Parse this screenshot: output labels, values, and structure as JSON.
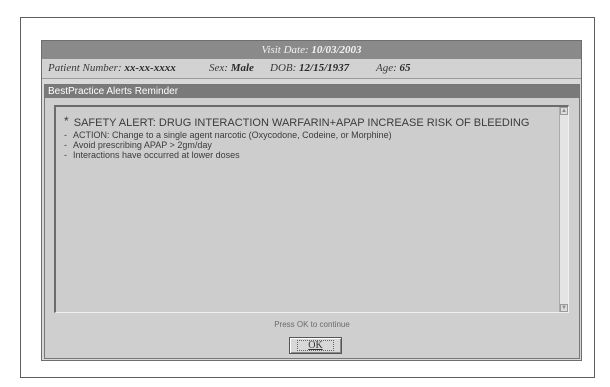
{
  "visit": {
    "label": "Visit Date:",
    "date": "10/03/2003"
  },
  "patient": {
    "number_label": "Patient Number:",
    "number": "xx-xx-xxxx",
    "sex_label": "Sex:",
    "sex": "Male",
    "dob_label": "DOB:",
    "dob": "12/15/1937",
    "age_label": "Age:",
    "age": "65"
  },
  "dialog": {
    "title": "BestPractice Alerts Reminder",
    "alert_marker": "*",
    "alert_headline": "SAFETY ALERT: DRUG INTERACTION WARFARIN+APAP INCREASE RISK OF BLEEDING",
    "items": [
      {
        "marker": "-",
        "text": "ACTION: Change to a single agent narcotic (Oxycodone, Codeine, or Morphine)"
      },
      {
        "marker": "-",
        "text": "Avoid prescribing APAP > 2gm/day"
      },
      {
        "marker": "-",
        "text": "Interactions have occurred at lower doses"
      }
    ],
    "hint": "Press OK to continue",
    "ok_label": "OK"
  }
}
